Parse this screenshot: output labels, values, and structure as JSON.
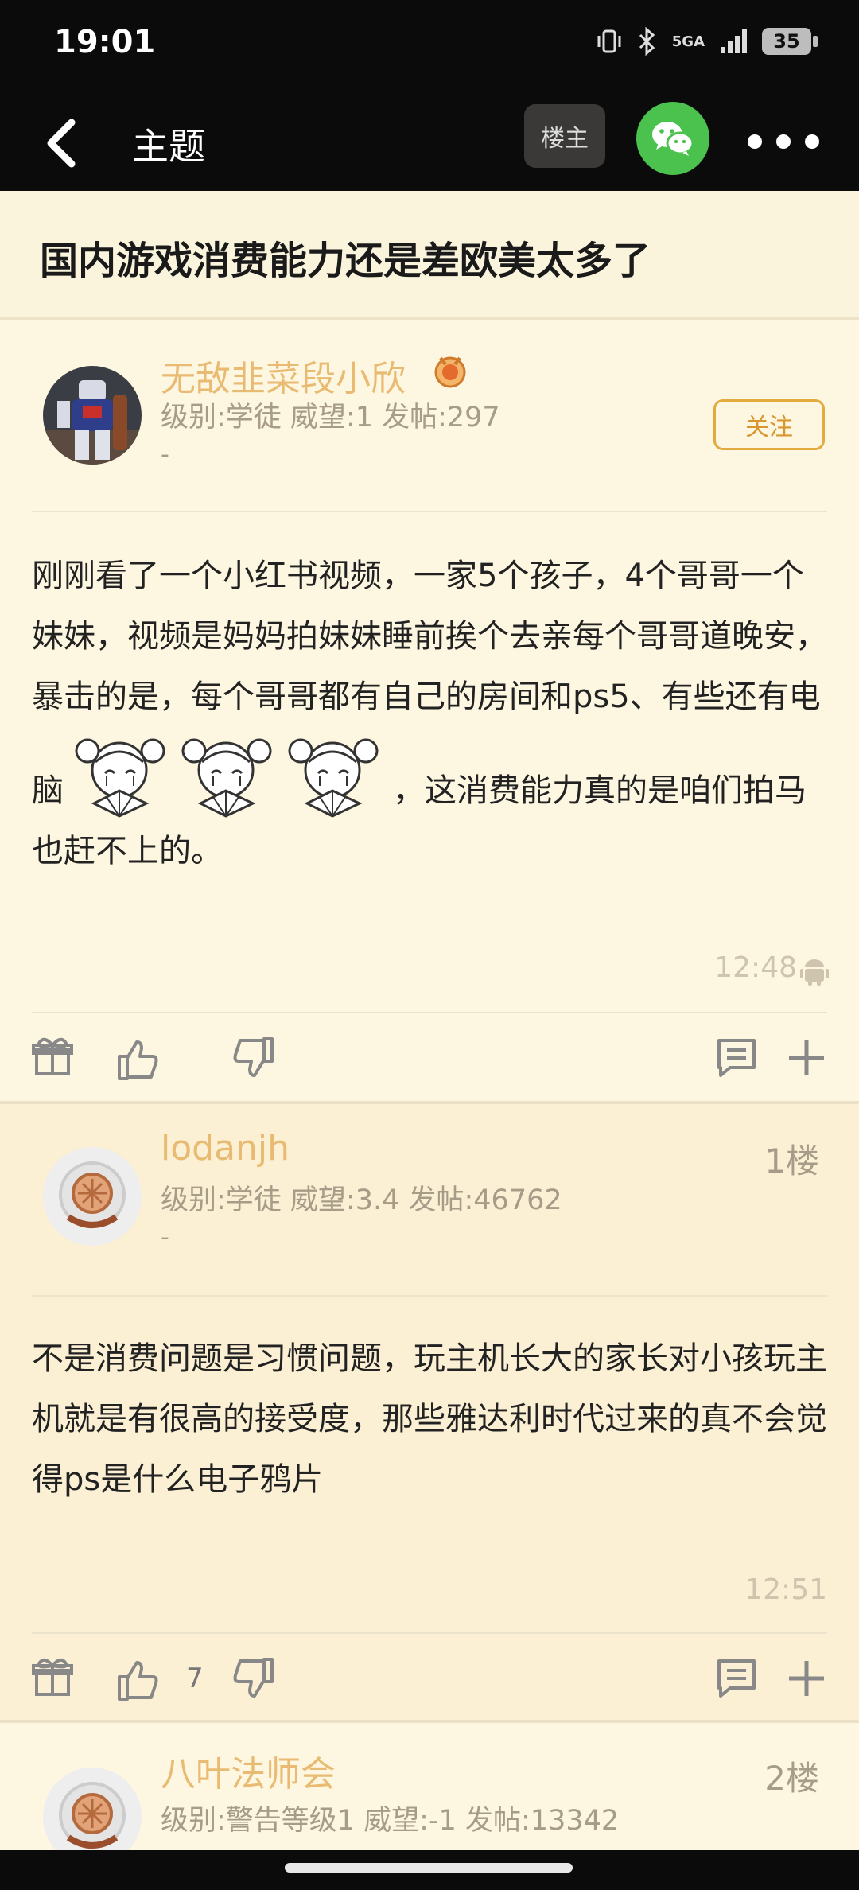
{
  "status_bar": {
    "time": "19:01",
    "network": "5GA",
    "battery": "35"
  },
  "nav": {
    "title": "主题",
    "owner_label": "楼主"
  },
  "topic": {
    "title": "国内游戏消费能力还是差欧美太多了"
  },
  "posts": [
    {
      "username": "无敌韭菜段小欣",
      "info": "级别:学徒 威望:1 发帖:297",
      "sub": "-",
      "follow_label": "关注",
      "content_part1": "刚刚看了一个小红书视频，一家5个孩子，4个哥哥一个妹妹，视频是妈妈拍妹妹睡前挨个去亲每个哥哥道晚安，暴击的是，每个哥哥都有自己的房间和ps5、有些还有电脑",
      "content_part2": "，这消费能力真的是咱们拍马也赶不上的。",
      "time": "12:48"
    },
    {
      "username": "lodanjh",
      "info": "级别:学徒 威望:3.4 发帖:46762",
      "sub": "-",
      "floor": "1楼",
      "content": "不是消费问题是习惯问题，玩主机长大的家长对小孩玩主机就是有很高的接受度，那些雅达利时代过来的真不会觉得ps是什么电子鸦片",
      "time": "12:51",
      "like_count": "7"
    },
    {
      "username": "八叶法师会",
      "info": "级别:警告等级1 威望:-1 发帖:13342",
      "floor": "2楼"
    }
  ]
}
